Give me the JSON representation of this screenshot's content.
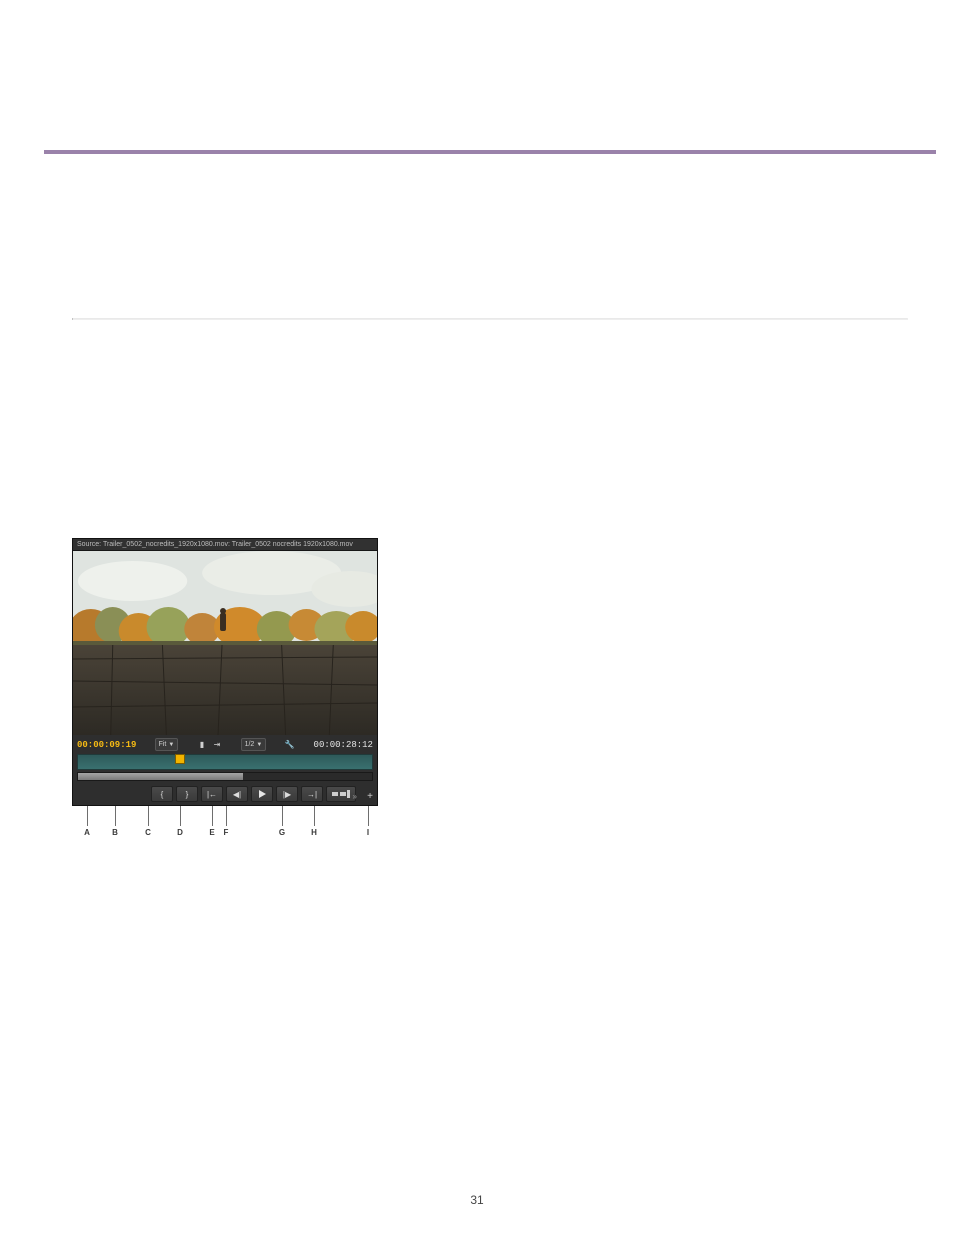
{
  "page_number": "31",
  "monitor": {
    "title": "Source: Trailer_0502_nocredits_1920x1080.mov: Trailer_0502 nocredits 1920x1080.mov",
    "timecode_in": "00:00:09:19",
    "timecode_out": "00:00:28:12",
    "fit_label": "Fit",
    "resolution_label": "1/2",
    "playhead_pct": 33,
    "zoom_thumb_pct": 56
  },
  "transport_buttons": {
    "mark_in_glyph": "{",
    "mark_out_glyph": "}",
    "go_in_glyph": "|←",
    "step_back_glyph": "◀|",
    "step_fwd_glyph": "|▶",
    "go_out_glyph": "→|",
    "insert_label": "insert",
    "add_glyph": "+",
    "more_glyph": "»"
  },
  "callout_labels": [
    "A",
    "B",
    "C",
    "D",
    "E",
    "F",
    "G",
    "H",
    "I"
  ]
}
